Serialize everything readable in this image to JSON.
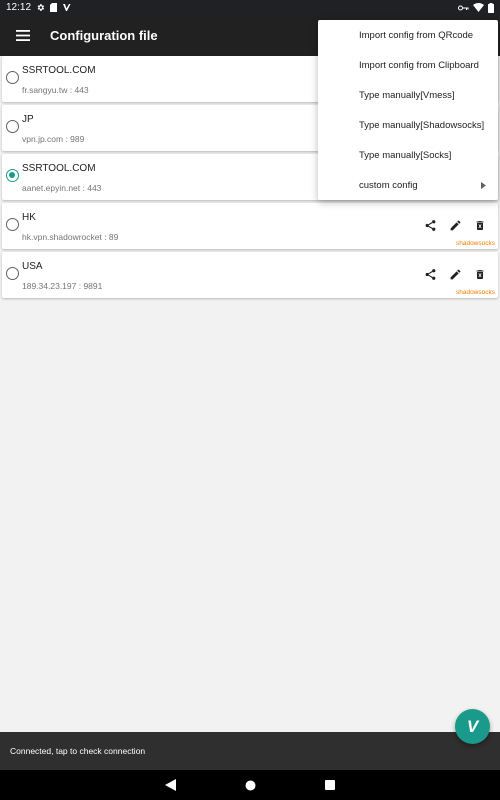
{
  "status_bar": {
    "time": "12:12",
    "left_icons": [
      "gear-icon",
      "sd-card-icon",
      "v2ray-icon"
    ],
    "right_icons": [
      "vpn-key-icon",
      "wifi-icon",
      "battery-icon"
    ]
  },
  "app_bar": {
    "title": "Configuration file",
    "menu_icon": "hamburger-menu-icon"
  },
  "servers": [
    {
      "name": "SSRTOOL.COM",
      "address": "fr.sangyu.tw : 443",
      "selected": false,
      "type": ""
    },
    {
      "name": "JP",
      "address": "vpn.jp.com : 989",
      "selected": false,
      "type": ""
    },
    {
      "name": "SSRTOOL.COM",
      "address": "aanet.epyin.net : 443",
      "selected": true,
      "type": ""
    },
    {
      "name": "HK",
      "address": "hk.vpn.shadowrocket : 89",
      "selected": false,
      "type": "shadowsocks"
    },
    {
      "name": "USA",
      "address": "189.34.23.197 : 9891",
      "selected": false,
      "type": "shadowsocks"
    }
  ],
  "row_actions": {
    "share": "share-icon",
    "edit": "edit-icon",
    "delete": "delete-icon"
  },
  "popup_menu": {
    "items": [
      "Import config from QRcode",
      "Import config from Clipboard",
      "Type manually[Vmess]",
      "Type manually[Shadowsocks]",
      "Type manually[Socks]",
      "custom config"
    ]
  },
  "snackbar": {
    "text": "Connected, tap to check connection"
  },
  "fab": {
    "label": "V",
    "icon": "v2ray-logo-icon"
  },
  "nav_bar": {
    "buttons": [
      "back-icon",
      "home-icon",
      "recents-icon"
    ]
  },
  "colors": {
    "accent": "#1a9a8a",
    "toolbar": "#212121",
    "type_tag": "#f57c00"
  }
}
